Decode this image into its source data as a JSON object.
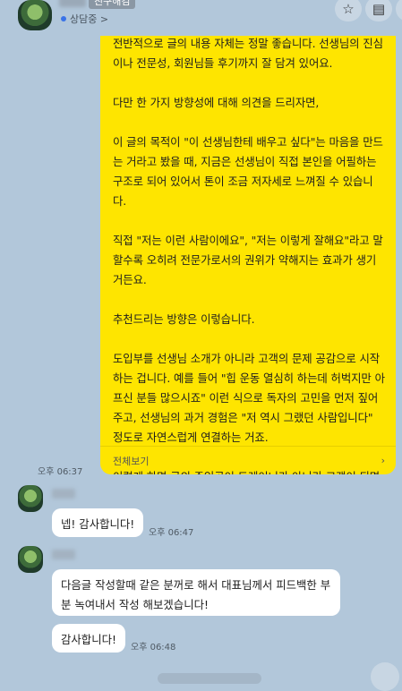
{
  "header": {
    "badge": "친구해김",
    "status": "상담중 >",
    "star_icon": "☆",
    "menu_icon": "▤",
    "more_icon": "⋯"
  },
  "big_message": {
    "paragraphs": [
      "전반적으로 글의 내용 자체는 정말 좋습니다. 선생님의 진심이나 전문성, 회원님들 후기까지 잘 담겨 있어요.",
      "다만 한 가지 방향성에 대해 의견을 드리자면,",
      "이 글의 목적이 \"이 선생님한테 배우고 싶다\"는 마음을 만드는 거라고 봤을 때, 지금은 선생님이 직접 본인을 어필하는 구조로 되어 있어서 톤이 조금 저자세로 느껴질 수 있습니다.",
      "직접 \"저는 이런 사람이에요\", \"저는 이렇게 잘해요\"라고 말할수록 오히려 전문가로서의 권위가 약해지는 효과가 생기거든요.",
      "추천드리는 방향은 이렇습니다.",
      "도입부를 선생님 소개가 아니라 고객의 문제 공감으로 시작하는 겁니다. 예를 들어 \"힙 운동 열심히 하는데 허벅지만 아프신 분들 많으시죠\" 이런 식으로 독자의 고민을 먼저 짚어주고, 선생님의 과거 경험은 \"저 역시 그랬던 사람입니다\" 정도로 자연스럽게 연결하는 거죠.",
      "이렇게 하면 글의 주인공이 트레이너가 아니라 고객이 되면서, ..."
    ],
    "view_all": "전체보기",
    "view_all_icon": "›",
    "time": "오후 06:37"
  },
  "messages": [
    {
      "text": "넵! 감사합니다!",
      "time": "오후 06:47"
    },
    {
      "text": "다음글 작성할때 같은 분꺼로 해서 대표님께서 피드백한 부분 녹여내서 작성 해보겠습니다!",
      "time": ""
    },
    {
      "text": "감사합니다!",
      "time": "오후 06:48"
    }
  ]
}
